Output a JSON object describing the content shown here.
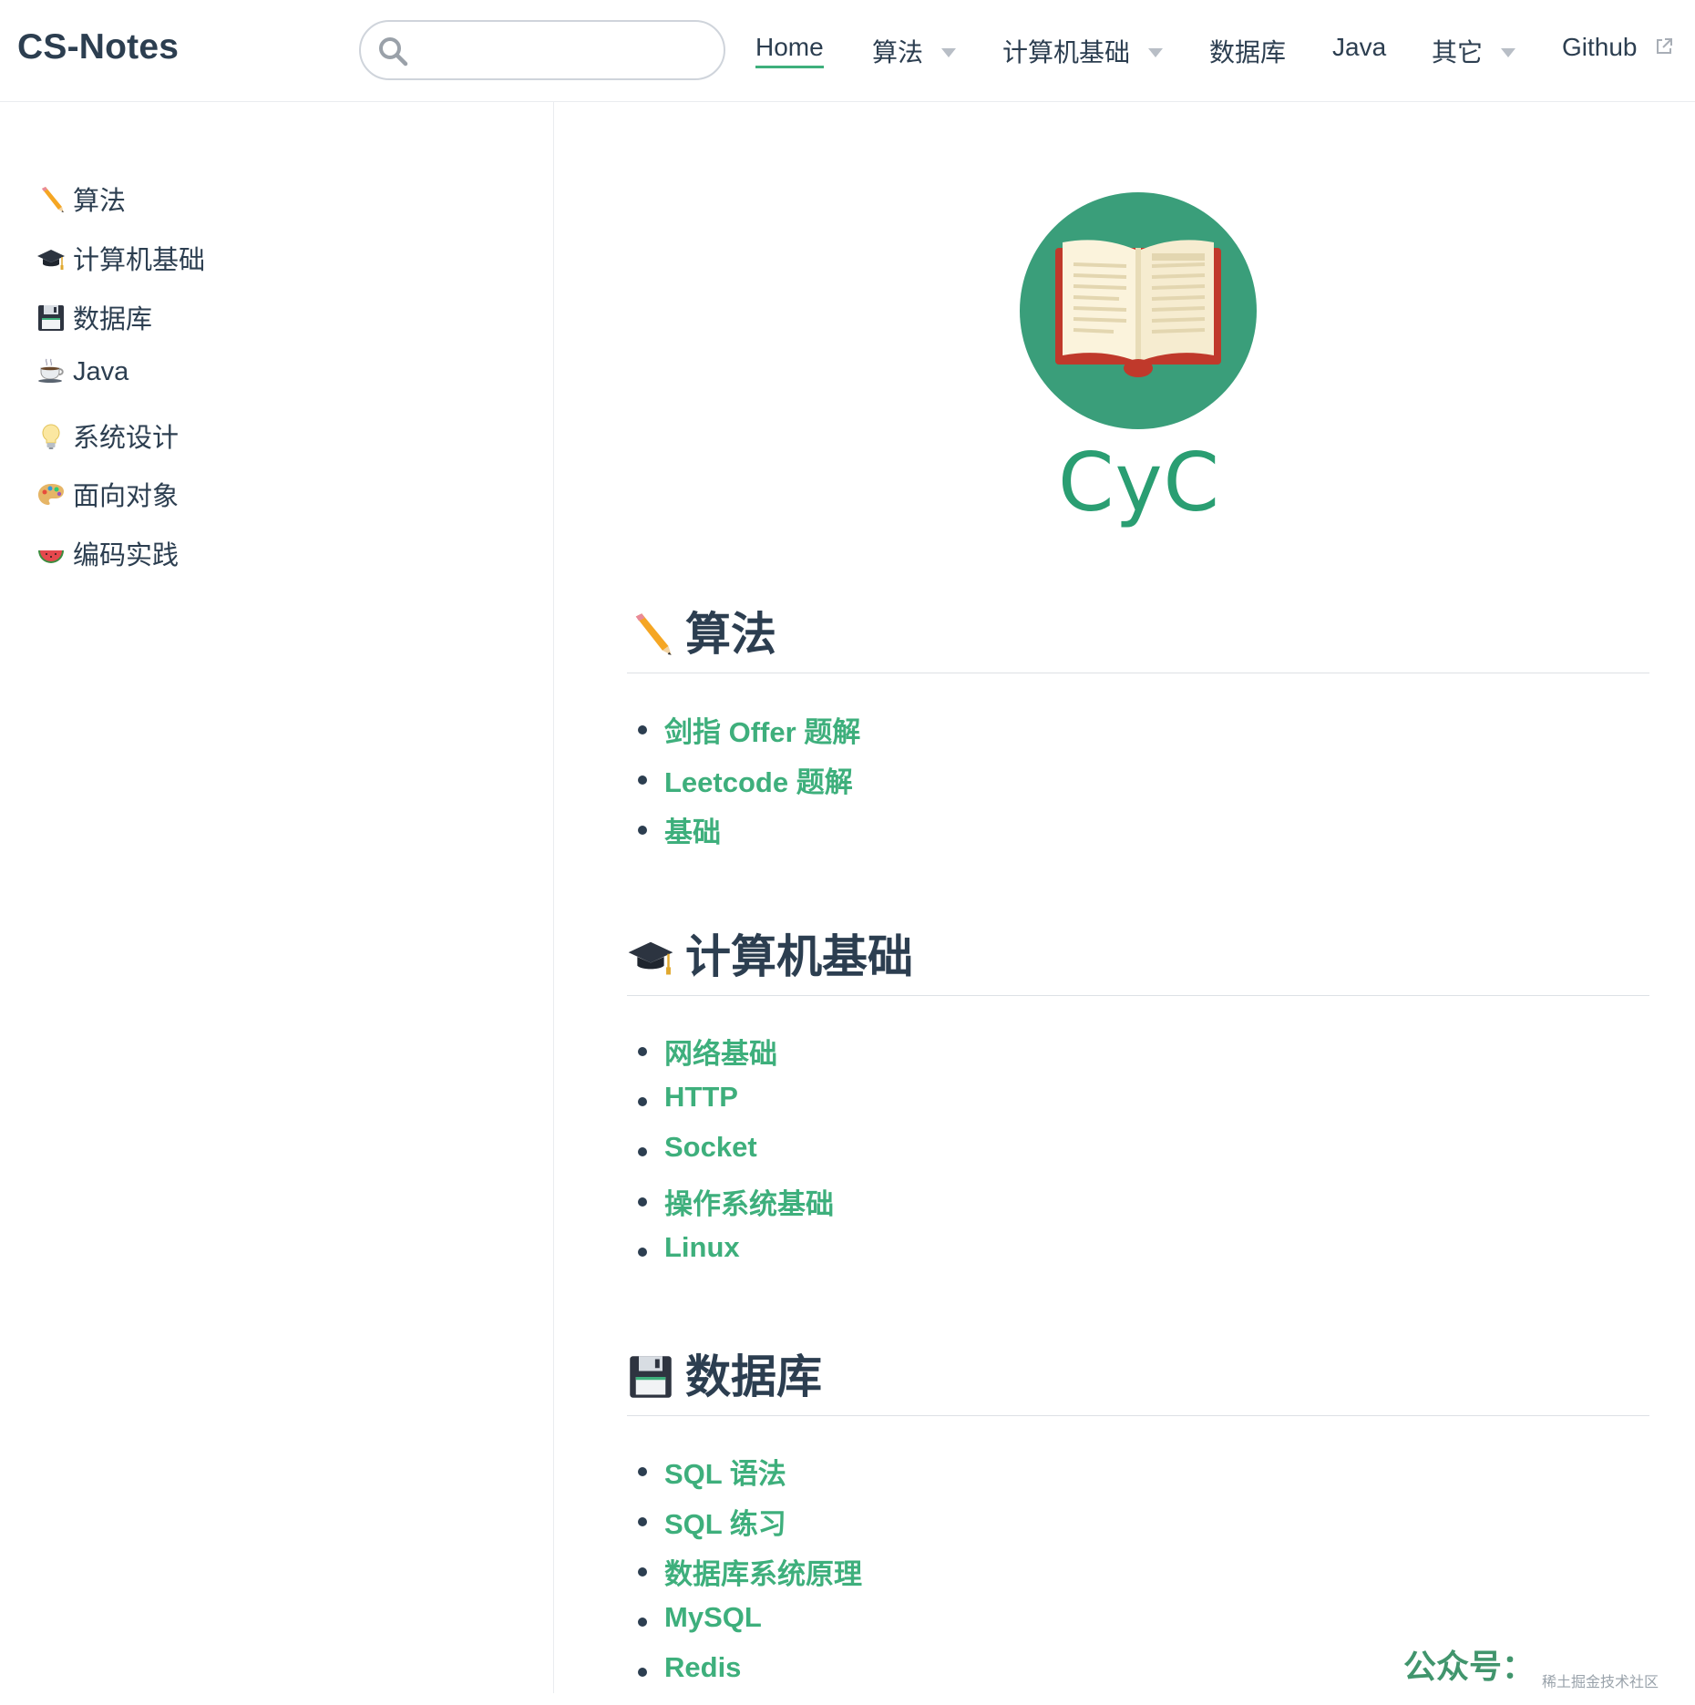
{
  "navbar": {
    "site_name": "CS-Notes",
    "search": {
      "value": "",
      "placeholder": ""
    },
    "items": [
      {
        "label": "Home",
        "active": true
      },
      {
        "label": "算法",
        "dropdown": true
      },
      {
        "label": "计算机基础",
        "dropdown": true
      },
      {
        "label": "数据库"
      },
      {
        "label": "Java"
      },
      {
        "label": "其它",
        "dropdown": true
      },
      {
        "label": "Github",
        "external": true
      }
    ]
  },
  "sidebar": {
    "items": [
      {
        "icon": "pencil-icon",
        "label": "算法"
      },
      {
        "icon": "graduation-cap-icon",
        "label": "计算机基础"
      },
      {
        "icon": "floppy-disk-icon",
        "label": "数据库"
      },
      {
        "icon": "coffee-icon",
        "label": "Java"
      },
      {
        "icon": "light-bulb-icon",
        "label": "系统设计"
      },
      {
        "icon": "palette-icon",
        "label": "面向对象"
      },
      {
        "icon": "watermelon-icon",
        "label": "编码实践"
      }
    ]
  },
  "main": {
    "logo_text": "CyC",
    "sections": [
      {
        "icon": "pencil-icon",
        "title": "算法",
        "links": [
          "剑指 Offer 题解",
          "Leetcode 题解",
          "基础"
        ]
      },
      {
        "icon": "graduation-cap-icon",
        "title": "计算机基础",
        "links": [
          "网络基础",
          "HTTP",
          "Socket",
          "操作系统基础",
          "Linux"
        ]
      },
      {
        "icon": "floppy-disk-icon",
        "title": "数据库",
        "links": [
          "SQL 语法",
          "SQL 练习",
          "数据库系统原理",
          "MySQL",
          "Redis"
        ]
      }
    ]
  },
  "watermark": {
    "text": "公众号：",
    "sub": "稀土掘金技术社区"
  },
  "colors": {
    "accent": "#3eaf7c",
    "text": "#2c3e50",
    "logo_bg": "#3a9e7a",
    "book_red": "#c0392b"
  }
}
